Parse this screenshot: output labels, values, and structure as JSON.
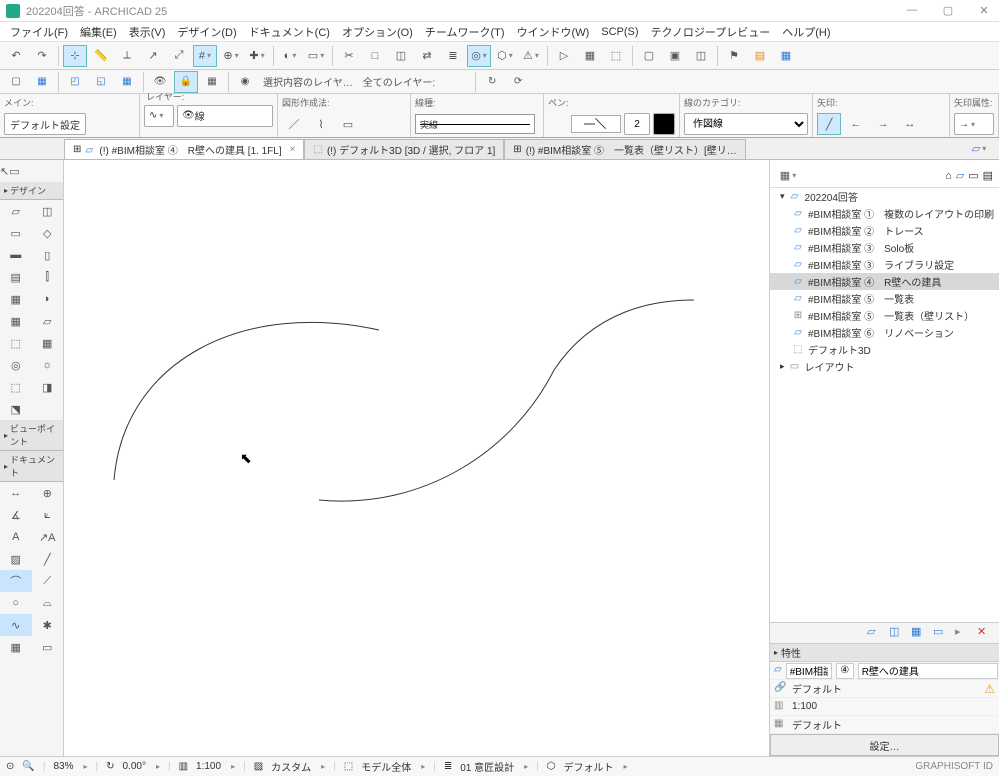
{
  "app": {
    "title": "202204回答 - ARCHICAD 25"
  },
  "menubar": [
    {
      "l": "ファイル(F)"
    },
    {
      "l": "編集(E)"
    },
    {
      "l": "表示(V)"
    },
    {
      "l": "デザイン(D)"
    },
    {
      "l": "ドキュメント(C)"
    },
    {
      "l": "オプション(O)"
    },
    {
      "l": "チームワーク(T)"
    },
    {
      "l": "ウインドウ(W)"
    },
    {
      "l": "SCP(S)"
    },
    {
      "l": "テクノロジープレビュー"
    },
    {
      "l": "ヘルプ(H)"
    }
  ],
  "toolbar2": {
    "selLayer": "選択内容のレイヤ…",
    "allLayer": "全てのレイヤー:"
  },
  "infobox": {
    "main_label": "メイン:",
    "main_value": "デフォルト設定",
    "layer_label": "レイヤー:",
    "layer_value": "線",
    "geom_label": "図形作成法:",
    "line_label": "線種:",
    "line_value": "実線",
    "pen_label": "ペン:",
    "pen_value": "2",
    "cat_label": "線のカテゴリ:",
    "cat_value": "作図線",
    "arrow_label": "矢印:",
    "arrowattr_label": "矢印属性:"
  },
  "tabs": [
    {
      "label": "(!) #BIM相談室 ④　R壁への建具 [1. 1FL]",
      "active": true,
      "close": true
    },
    {
      "label": "(!) デフォルト3D [3D / 選択, フロア 1]",
      "active": false,
      "close": false
    },
    {
      "label": "(!) #BIM相談室 ⑤　一覧表（壁リスト）[壁リ…",
      "active": false,
      "close": false
    }
  ],
  "palettes": {
    "design": "デザイン",
    "viewpoint": "ビューポイント",
    "document": "ドキュメント"
  },
  "navigator": {
    "root": "202204回答",
    "items": [
      {
        "label": "#BIM相談室 ①　複数のレイアウトの印刷",
        "icon": "fp"
      },
      {
        "label": "#BIM相談室 ②　トレース",
        "icon": "fp"
      },
      {
        "label": "#BIM相談室 ③　Solo板",
        "icon": "fp"
      },
      {
        "label": "#BIM相談室 ③　ライブラリ設定",
        "icon": "fp"
      },
      {
        "label": "#BIM相談室 ④　R壁への建具",
        "icon": "fp",
        "sel": true
      },
      {
        "label": "#BIM相談室 ⑤　一覧表",
        "icon": "fp"
      },
      {
        "label": "#BIM相談室 ⑤　一覧表（壁リスト）",
        "icon": "grid"
      },
      {
        "label": "#BIM相談室 ⑥　リノベーション",
        "icon": "fp"
      },
      {
        "label": "デフォルト3D",
        "icon": "cube"
      }
    ],
    "layout": "レイアウト"
  },
  "properties": {
    "title": "特性",
    "tag": "#BIM相談",
    "idx": "④",
    "name": "R壁への建具",
    "linkset": "デフォルト",
    "scale": "1:100",
    "penset": "デフォルト",
    "settings_btn": "設定…"
  },
  "status": {
    "zoom": "83%",
    "angle": "0.00°",
    "scale": "1:100",
    "custom": "カスタム",
    "model": "モデル全体",
    "layercombo": "01 意匠設計",
    "def": "デフォルト",
    "brand": "GRAPHISOFT ID"
  }
}
